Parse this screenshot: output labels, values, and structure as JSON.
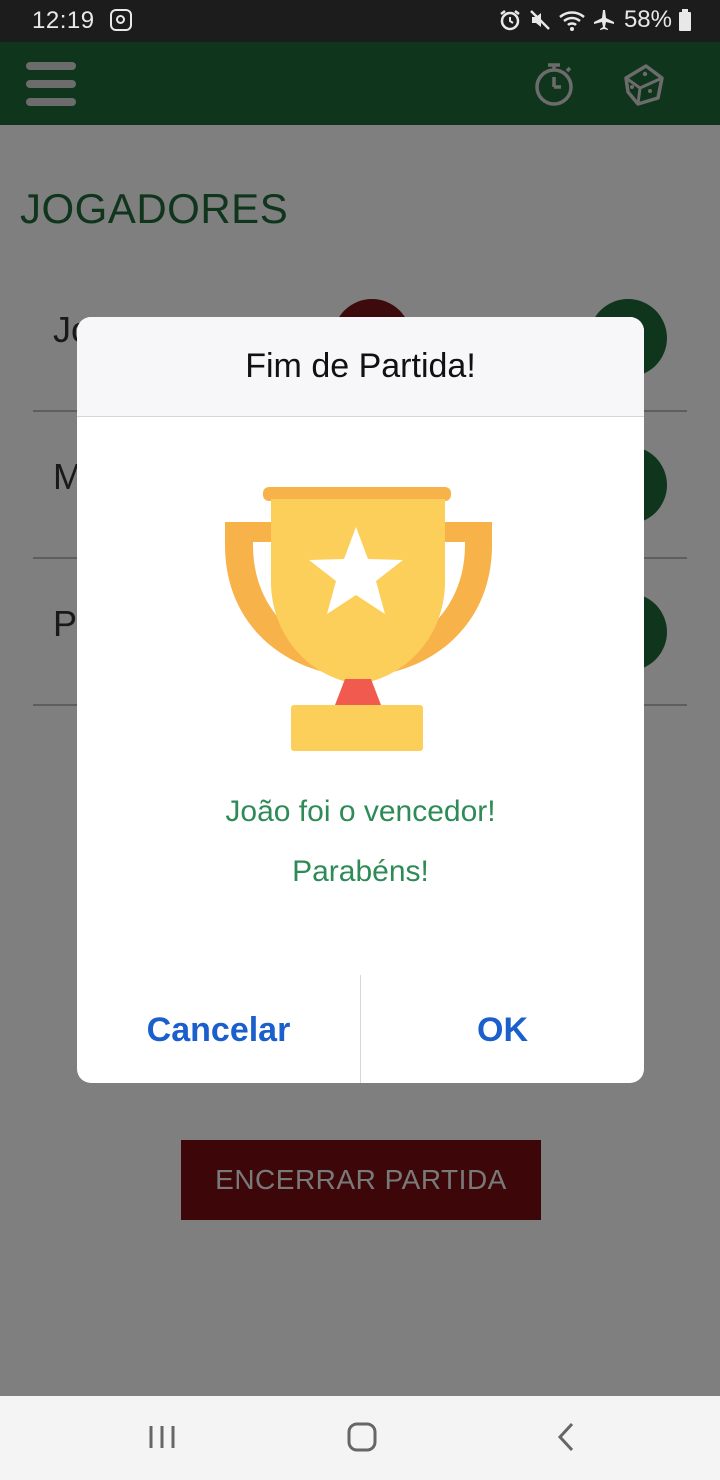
{
  "status_bar": {
    "time": "12:19",
    "battery_percent": "58%",
    "icons": [
      "instagram-icon",
      "alarm-icon",
      "mute-icon",
      "wifi-icon",
      "airplane-icon",
      "battery-icon"
    ]
  },
  "app_bar": {
    "menu_icon": "hamburger-menu-icon",
    "timer_icon": "stopwatch-icon",
    "dice_icon": "dice-icon",
    "color": "#1e6b3a"
  },
  "main": {
    "section_title": "JOGADORES",
    "players": [
      {
        "name": "Jo"
      },
      {
        "name": "M"
      },
      {
        "name": "P"
      }
    ],
    "end_button_label": "ENCERRAR PARTIDA"
  },
  "dialog": {
    "title": "Fim de Partida!",
    "image": "trophy-icon",
    "winner_message": "João foi o vencedor!",
    "congrats_message": "Parabéns!",
    "cancel_label": "Cancelar",
    "ok_label": "OK"
  },
  "nav_bar": {
    "recents_icon": "recent-apps-icon",
    "home_icon": "home-icon",
    "back_icon": "back-icon"
  }
}
